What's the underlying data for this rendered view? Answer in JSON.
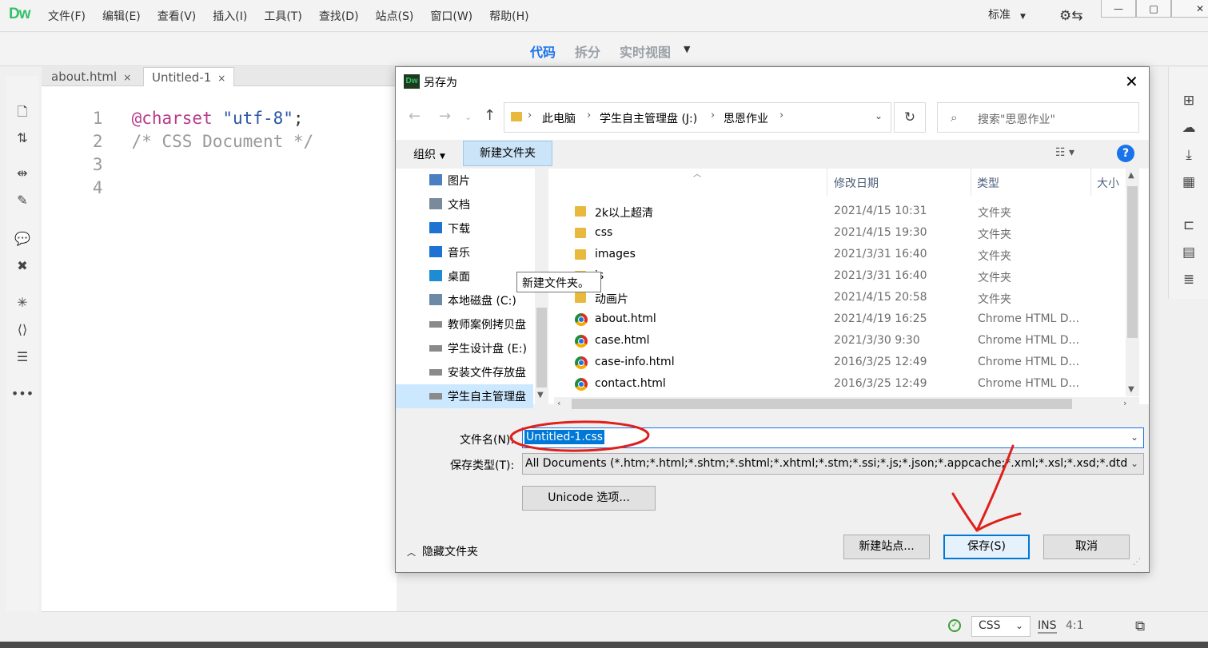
{
  "app": {
    "logo": "Dw",
    "menu": [
      "文件(F)",
      "编辑(E)",
      "查看(V)",
      "插入(I)",
      "工具(T)",
      "查找(D)",
      "站点(S)",
      "窗口(W)",
      "帮助(H)"
    ],
    "workspace": "标准",
    "window_buttons": [
      "—",
      "□",
      "✕"
    ]
  },
  "view_tabs": {
    "code": "代码",
    "split": "拆分",
    "live": "实时视图"
  },
  "doc_tabs": [
    {
      "label": "about.html",
      "close": "×"
    },
    {
      "label": "Untitled-1",
      "close": "×"
    }
  ],
  "editor": {
    "line_numbers": [
      "1",
      "2",
      "3",
      "4"
    ],
    "line1_kw": "@charset",
    "line1_str": "\"utf-8\"",
    "line1_end": ";",
    "line2": "/* CSS Document */"
  },
  "status": {
    "language": "CSS",
    "mode": "INS",
    "position": "4:1"
  },
  "dialog": {
    "title": "另存为",
    "close": "✕",
    "breadcrumbs": [
      "此电脑",
      "学生自主管理盘 (J:)",
      "思恩作业"
    ],
    "search_placeholder": "搜索\"思恩作业\"",
    "organize": "组织",
    "new_folder": "新建文件夹",
    "tooltip": "新建文件夹。",
    "help": "?",
    "nav_items": [
      {
        "label": "图片",
        "icon": "pictures-icon",
        "color": "#4a7fc1"
      },
      {
        "label": "文档",
        "icon": "documents-icon",
        "color": "#7a8a9a"
      },
      {
        "label": "下载",
        "icon": "downloads-icon",
        "color": "#1e73d2"
      },
      {
        "label": "音乐",
        "icon": "music-icon",
        "color": "#1e73d2"
      },
      {
        "label": "桌面",
        "icon": "desktop-icon",
        "color": "#1e8cd2"
      },
      {
        "label": "本地磁盘 (C:)",
        "icon": "local-disk-icon",
        "color": "#6a8aa6"
      },
      {
        "label": "教师案例拷贝盘",
        "icon": "drive-icon",
        "color": "#8a8a8a"
      },
      {
        "label": "学生设计盘 (E:)",
        "icon": "drive-icon",
        "color": "#8a8a8a"
      },
      {
        "label": "安装文件存放盘",
        "icon": "drive-icon",
        "color": "#8a8a8a"
      },
      {
        "label": "学生自主管理盘",
        "icon": "drive-icon",
        "color": "#8a8a8a"
      }
    ],
    "columns": {
      "date": "修改日期",
      "type": "类型",
      "size": "大小"
    },
    "files": [
      {
        "name": "2k以上超清",
        "date": "2021/4/15 10:31",
        "type": "文件夹",
        "kind": "folder"
      },
      {
        "name": "css",
        "date": "2021/4/15 19:30",
        "type": "文件夹",
        "kind": "folder"
      },
      {
        "name": "images",
        "date": "2021/3/31 16:40",
        "type": "文件夹",
        "kind": "folder"
      },
      {
        "name": "js",
        "date": "2021/3/31 16:40",
        "type": "文件夹",
        "kind": "folder"
      },
      {
        "name": "动画片",
        "date": "2021/4/15 20:58",
        "type": "文件夹",
        "kind": "folder"
      },
      {
        "name": "about.html",
        "date": "2021/4/19 16:25",
        "type": "Chrome HTML D...",
        "kind": "chrome"
      },
      {
        "name": "case.html",
        "date": "2021/3/30 9:30",
        "type": "Chrome HTML D...",
        "kind": "chrome"
      },
      {
        "name": "case-info.html",
        "date": "2016/3/25 12:49",
        "type": "Chrome HTML D...",
        "kind": "chrome"
      },
      {
        "name": "contact.html",
        "date": "2016/3/25 12:49",
        "type": "Chrome HTML D...",
        "kind": "chrome"
      }
    ],
    "filename_label": "文件名(N):",
    "filename_value": "Untitled-1.css",
    "filetype_label": "保存类型(T):",
    "filetype_value": "All Documents (*.htm;*.html;*.shtm;*.shtml;*.xhtml;*.stm;*.ssi;*.js;*.json;*.appcache;*.xml;*.xsl;*.xsd;*.dtd",
    "unicode_button": "Unicode 选项...",
    "hide_folders": "隐藏文件夹",
    "new_site_button": "新建站点...",
    "save_button": "保存(S)",
    "cancel_button": "取消"
  },
  "colors": {
    "accent": "#1a73e8",
    "annotation": "#e0201a",
    "selection": "#0078d7",
    "dw_green": "#35c16b"
  }
}
